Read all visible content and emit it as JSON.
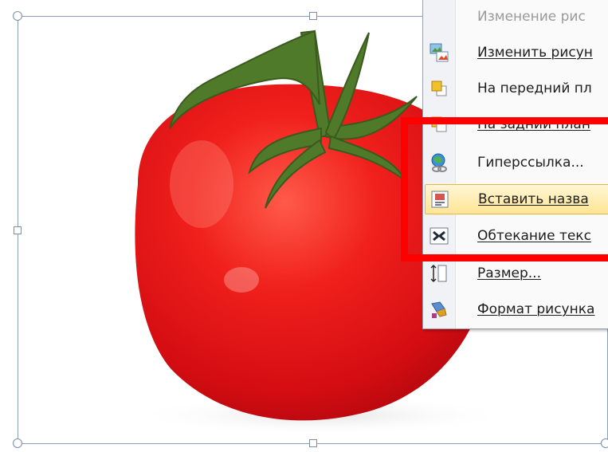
{
  "menu": {
    "items": [
      {
        "label": "Изменение рис",
        "icon": "change-picture-disabled-icon",
        "disabled": true
      },
      {
        "label": "Изменить рисун",
        "icon": "change-picture-icon"
      },
      {
        "label": "На передний пл",
        "icon": "bring-forward-icon"
      },
      {
        "label": "На задний план",
        "icon": "send-backward-icon"
      },
      {
        "label": "Гиперссылка...",
        "icon": "hyperlink-icon"
      },
      {
        "label": "Вставить назва",
        "icon": "insert-caption-icon",
        "highlighted": true
      },
      {
        "label": "Обтекание текс",
        "icon": "text-wrap-icon"
      },
      {
        "label": "Размер...",
        "icon": "size-icon"
      },
      {
        "label": "Формат рисунка",
        "icon": "format-picture-icon"
      }
    ]
  },
  "colors": {
    "highlight": "#ffe594",
    "annotation": "#ff0000",
    "tomato": "#e8141a"
  }
}
